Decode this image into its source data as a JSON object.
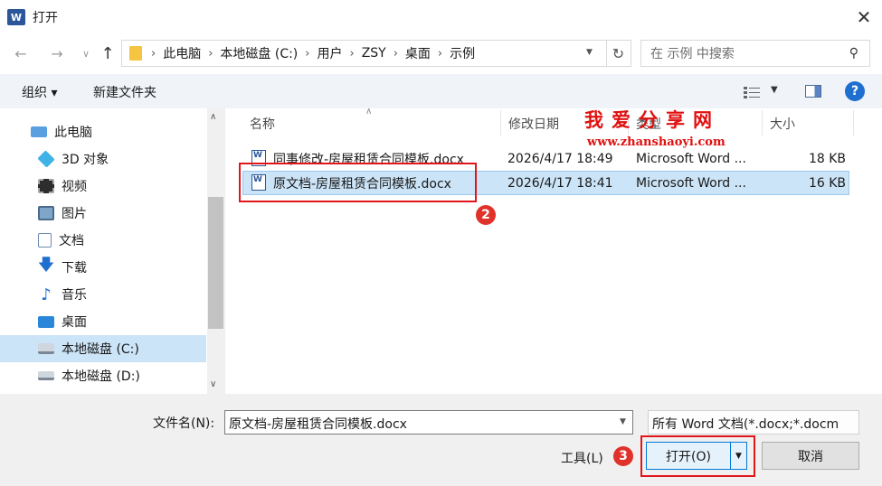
{
  "window": {
    "title": "打开",
    "app_icon": "word-icon",
    "close": "✕"
  },
  "nav": {
    "breadcrumb": [
      "此电脑",
      "本地磁盘 (C:)",
      "用户",
      "ZSY",
      "桌面",
      "示例"
    ],
    "search_placeholder": "在 示例 中搜索"
  },
  "toolbar": {
    "organize": "组织 ▾",
    "new_folder": "新建文件夹",
    "help": "?"
  },
  "sidebar": {
    "items": [
      {
        "label": "此电脑",
        "icon": "computer-icon"
      },
      {
        "label": "3D 对象",
        "icon": "3d-objects-icon"
      },
      {
        "label": "视频",
        "icon": "video-icon"
      },
      {
        "label": "图片",
        "icon": "pictures-icon"
      },
      {
        "label": "文档",
        "icon": "documents-icon"
      },
      {
        "label": "下载",
        "icon": "download-icon"
      },
      {
        "label": "音乐",
        "icon": "music-icon"
      },
      {
        "label": "桌面",
        "icon": "desktop-icon"
      },
      {
        "label": "本地磁盘 (C:)",
        "icon": "drive-c-icon",
        "selected": true
      },
      {
        "label": "本地磁盘 (D:)",
        "icon": "drive-d-icon"
      }
    ]
  },
  "columns": {
    "name": "名称",
    "modified": "修改日期",
    "type": "类型",
    "size": "大小"
  },
  "files": [
    {
      "name": "同事修改-房屋租赁合同模板.docx",
      "modified": "2026/4/17 18:49",
      "type": "Microsoft Word ...",
      "size": "18 KB"
    },
    {
      "name": "原文档-房屋租赁合同模板.docx",
      "modified": "2026/4/17 18:41",
      "type": "Microsoft Word ...",
      "size": "16 KB",
      "selected": true
    }
  ],
  "watermark": {
    "title": "我爱分享网",
    "url": "www.zhanshaoyi.com"
  },
  "annotations": {
    "step2": "2",
    "step3": "3",
    "color": "#e0161b"
  },
  "bottom": {
    "filename_label": "文件名(N):",
    "filename_value": "原文档-房屋租赁合同模板.docx",
    "filter": "所有 Word 文档(*.docx;*.docm",
    "tools": "工具(L)",
    "open": "打开(O)",
    "cancel": "取消"
  }
}
